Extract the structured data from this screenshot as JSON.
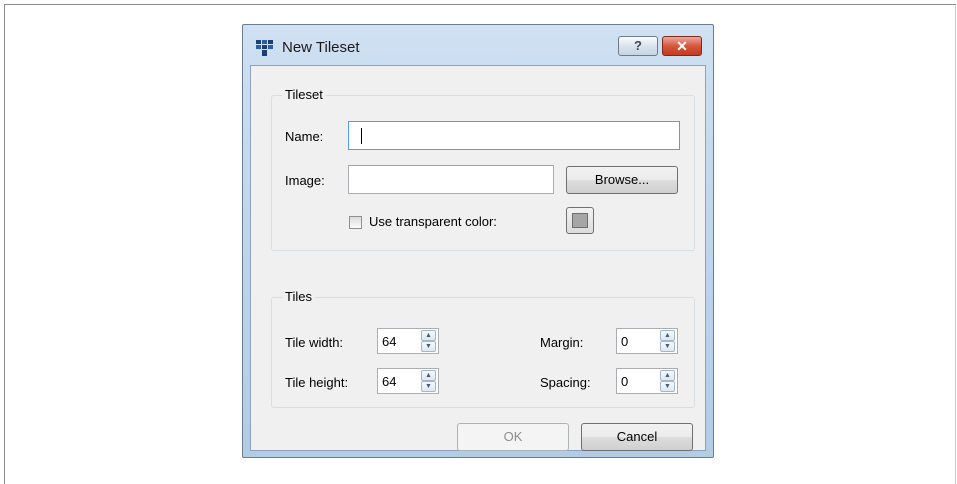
{
  "window": {
    "title": "New Tileset",
    "help_label": "?",
    "close_label": "✕"
  },
  "tileset_group": {
    "title": "Tileset",
    "name_label": "Name:",
    "name_value": "",
    "image_label": "Image:",
    "image_value": "",
    "browse_label": "Browse...",
    "transparent_label": "Use transparent color:",
    "transparent_checked": false,
    "transparent_color": "#a6a6a6"
  },
  "tiles_group": {
    "title": "Tiles",
    "tile_width_label": "Tile width:",
    "tile_width": "64",
    "tile_height_label": "Tile height:",
    "tile_height": "64",
    "margin_label": "Margin:",
    "margin": "0",
    "spacing_label": "Spacing:",
    "spacing": "0"
  },
  "buttons": {
    "ok": "OK",
    "cancel": "Cancel"
  },
  "icons": {
    "app": "tileset-grid-icon",
    "spin_up": "spin-up-arrow-icon",
    "spin_down": "spin-down-arrow-icon"
  }
}
